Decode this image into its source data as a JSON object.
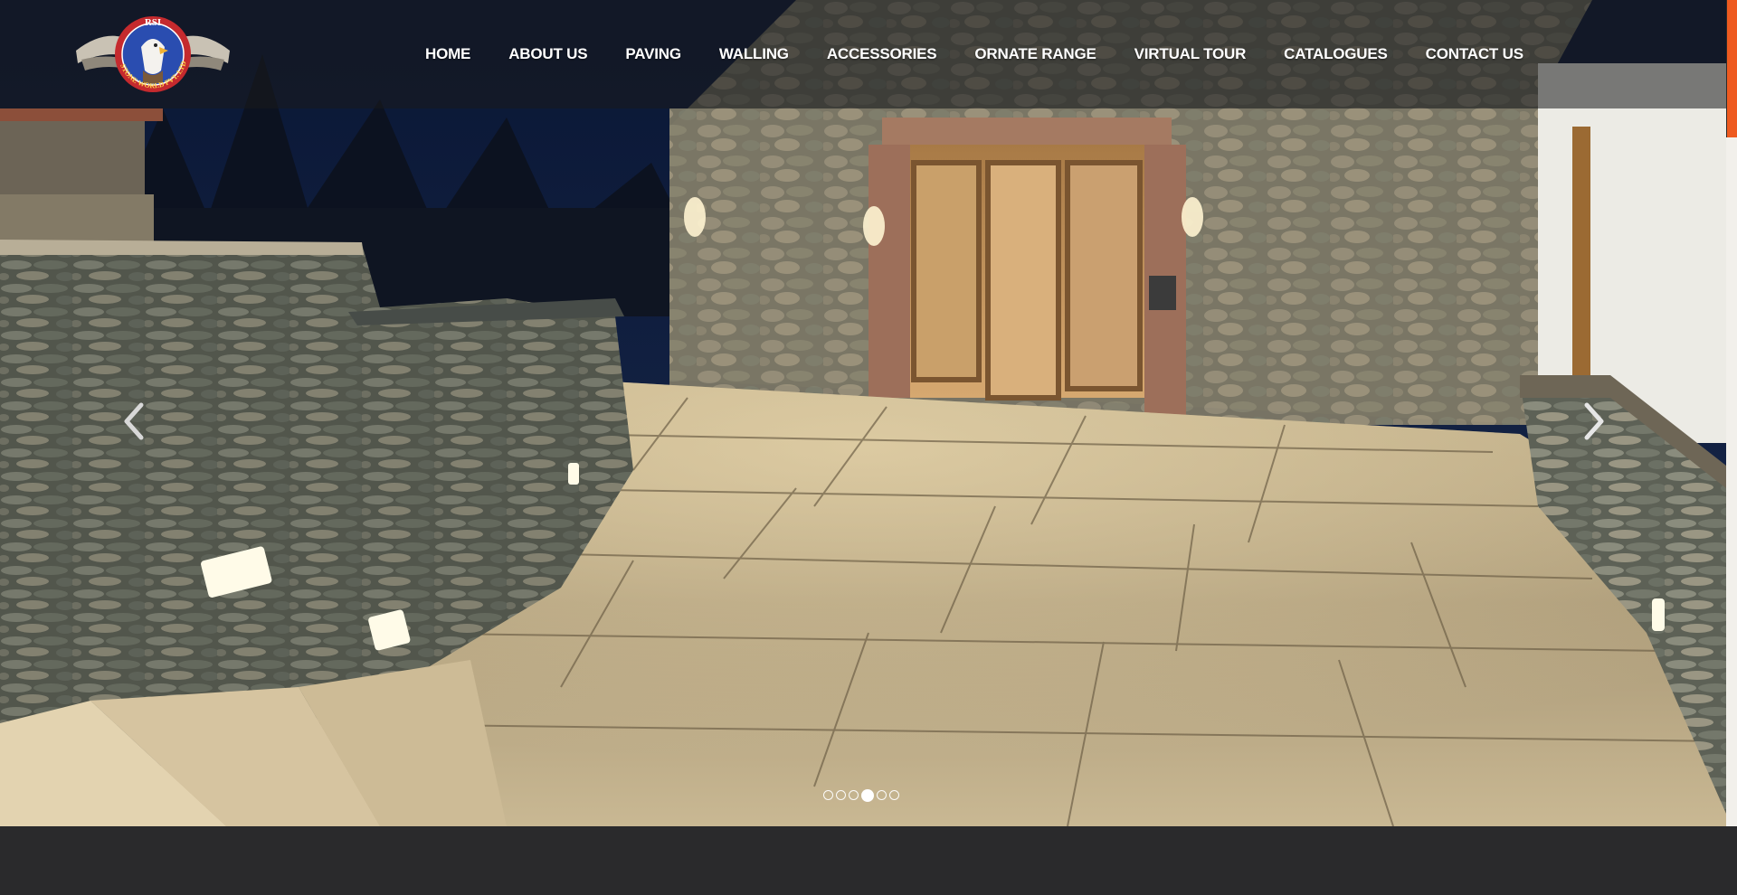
{
  "brand": {
    "logo_text_top": "RSI",
    "logo_text_ring": "STONE WORLD PVT. LTD."
  },
  "nav": {
    "items": [
      {
        "label": "HOME"
      },
      {
        "label": "ABOUT US"
      },
      {
        "label": "PAVING"
      },
      {
        "label": "WALLING"
      },
      {
        "label": "ACCESSORIES"
      },
      {
        "label": "ORNATE RANGE"
      },
      {
        "label": "VIRTUAL TOUR"
      },
      {
        "label": "CATALOGUES"
      },
      {
        "label": "CONTACT US"
      }
    ]
  },
  "slider": {
    "prev_icon": "chevron-left-icon",
    "next_icon": "chevron-right-icon",
    "slide_count": 6,
    "active_slide": 4
  },
  "colors": {
    "accent": "#ee5a1f",
    "header_overlay": "rgba(25,25,28,0.55)",
    "bottom_band": "#2a2a2c"
  }
}
